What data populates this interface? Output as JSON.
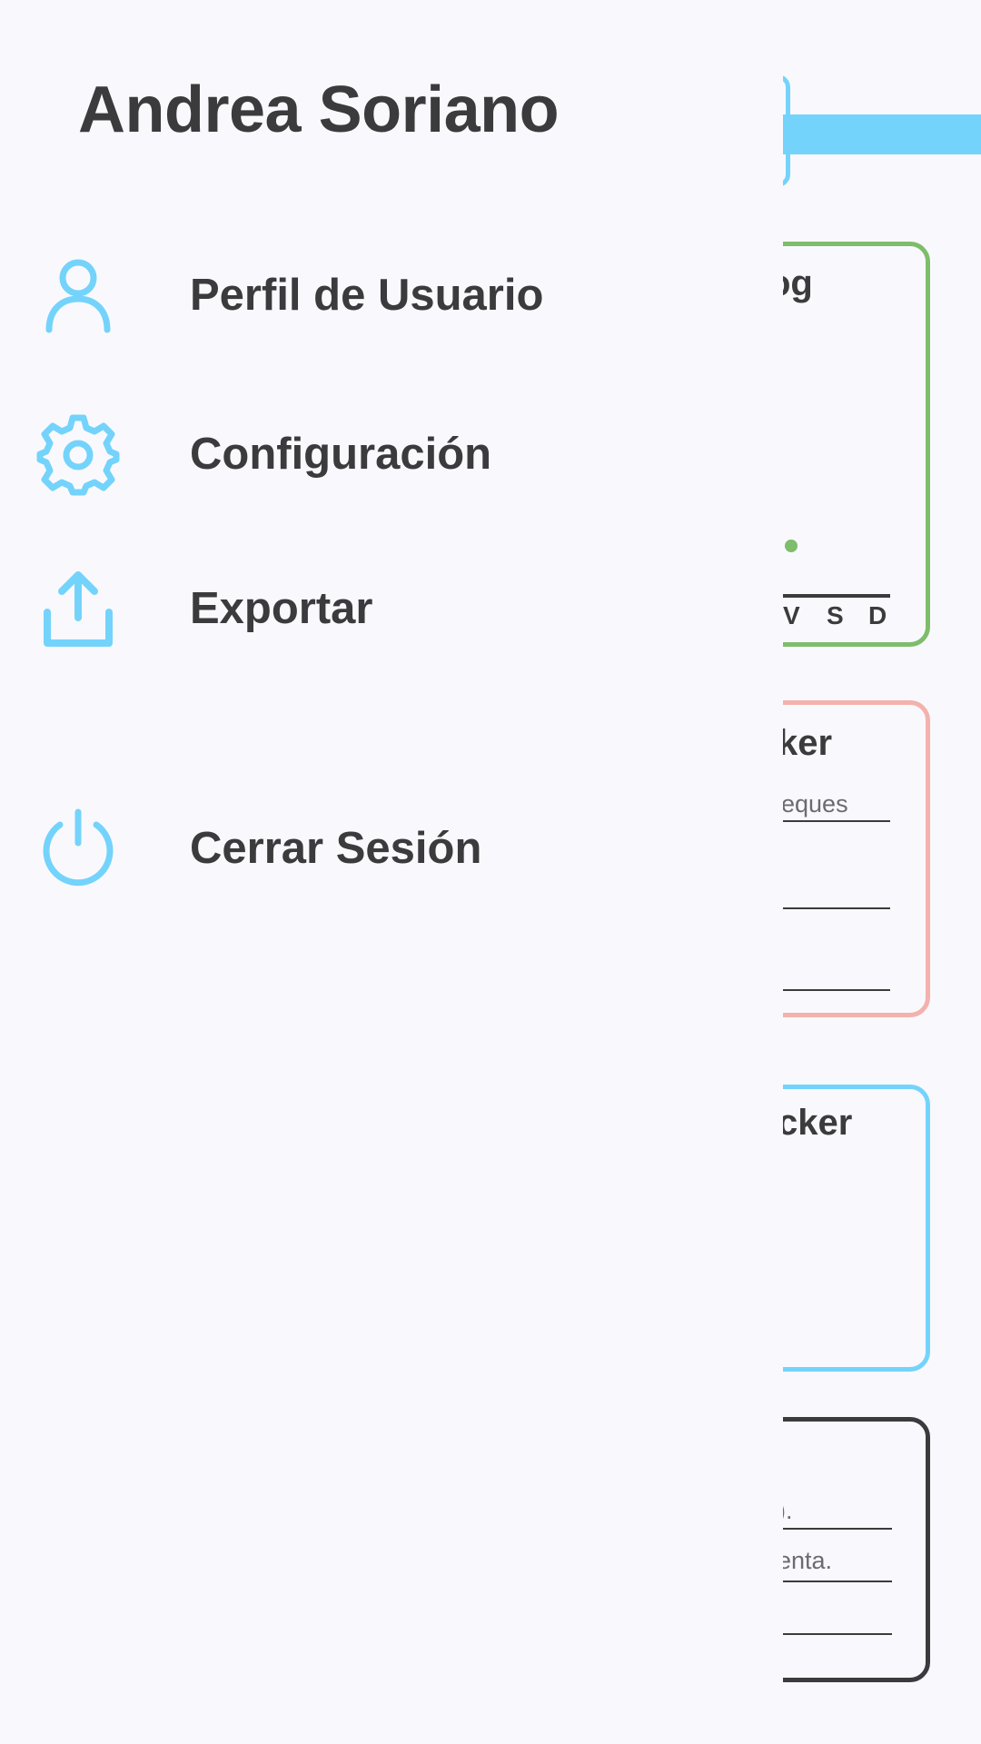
{
  "drawer": {
    "user_name": "Andrea Soriano",
    "items": [
      {
        "label": "Perfil de Usuario",
        "icon": "user-icon"
      },
      {
        "label": "Configuración",
        "icon": "gear-icon"
      },
      {
        "label": "Exportar",
        "icon": "upload-icon"
      },
      {
        "label": "Cerrar Sesión",
        "icon": "power-icon"
      }
    ]
  },
  "background": {
    "card_green_title": "og",
    "card_green_days": [
      "V",
      "S",
      "D"
    ],
    "card_red_title": "ker",
    "card_red_line": "eques",
    "card_blue_title": "cker",
    "card_dark_lines": [
      ").",
      "enta."
    ]
  },
  "colors": {
    "accent": "#74d3fb",
    "text": "#3b3b3e",
    "background": "#f9f9fd",
    "green": "#7dbd6b",
    "red": "#f4b1ad"
  }
}
